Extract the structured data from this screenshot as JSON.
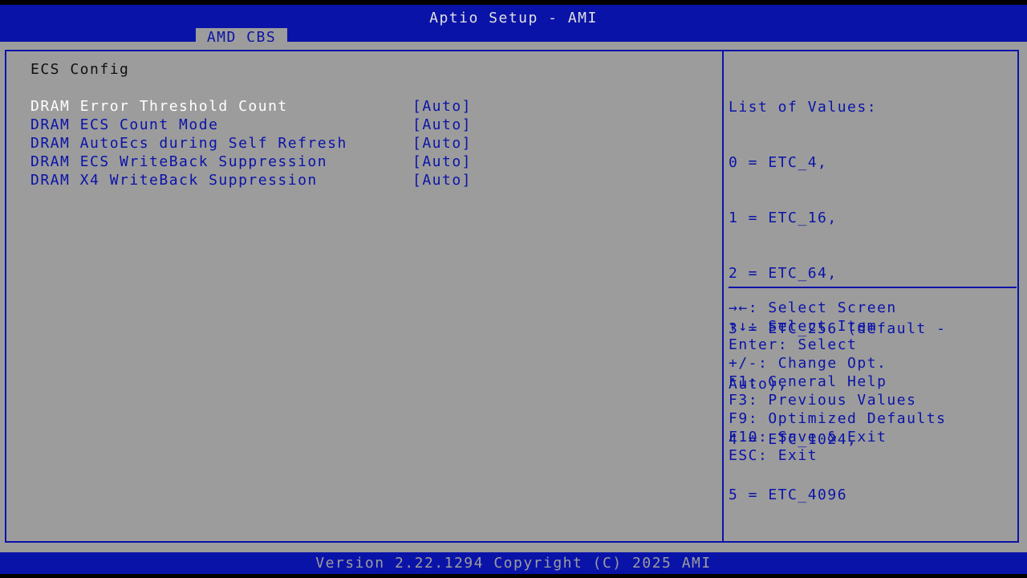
{
  "header": {
    "title": "Aptio Setup - AMI",
    "active_tab": "AMD CBS"
  },
  "page": {
    "section_title": "ECS Config",
    "items": [
      {
        "label": "DRAM Error Threshold Count",
        "value": "[Auto]"
      },
      {
        "label": "DRAM ECS Count Mode",
        "value": "[Auto]"
      },
      {
        "label": "DRAM AutoEcs during Self Refresh",
        "value": "[Auto]"
      },
      {
        "label": "DRAM ECS WriteBack Suppression",
        "value": "[Auto]"
      },
      {
        "label": "DRAM X4 WriteBack Suppression",
        "value": "[Auto]"
      }
    ]
  },
  "help": {
    "lines": [
      "List of Values:",
      "0 = ETC_4,",
      "1 = ETC_16,",
      "2 = ETC_64,",
      "3 = ETC_256 (default -",
      "Auto),",
      "4 = ETC_1024,",
      "5 = ETC_4096"
    ]
  },
  "keys": [
    {
      "key": "→←",
      "action": ": Select Screen"
    },
    {
      "key": "↑↓",
      "action": ": Select Item"
    },
    {
      "key": "Enter",
      "action": ": Select"
    },
    {
      "key": "+/-",
      "action": ": Change Opt."
    },
    {
      "key": "F1",
      "action": ": General Help"
    },
    {
      "key": "F3",
      "action": ": Previous Values"
    },
    {
      "key": "F9",
      "action": ": Optimized Defaults"
    },
    {
      "key": "F10",
      "action": ": Save & Exit"
    },
    {
      "key": "ESC",
      "action": ": Exit"
    }
  ],
  "footer": {
    "version": "Version 2.22.1294 Copyright (C) 2025 AMI"
  },
  "colors": {
    "bios_blue": "#0A13A8",
    "panel_gray": "#9C9C9C",
    "selected_text": "#FFFFFF"
  }
}
